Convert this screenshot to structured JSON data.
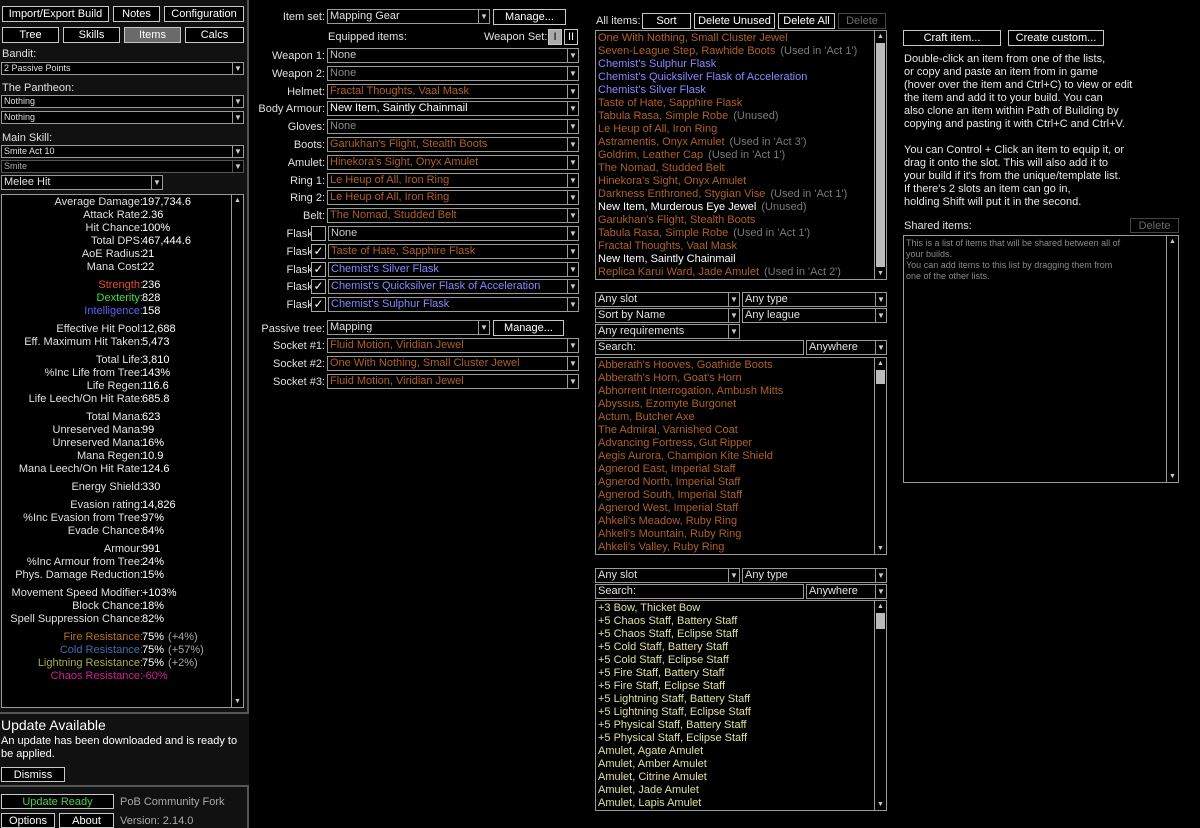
{
  "colors": {
    "unique": "#af6025",
    "magic": "#8888ff",
    "normal": "#c8c8c8",
    "gem": "#c8c8c8",
    "strength": "#e05030",
    "dexterity": "#40e040",
    "intelligence": "#6060f0",
    "fire": "#b97123",
    "cold": "#3f6db3",
    "lightning": "#adaa47",
    "chaos": "#d02090",
    "relic": "#e0e0a0",
    "green": "#50d050",
    "panel_bg": "#0c0c10"
  },
  "top_buttons": {
    "import_export": "Import/Export Build",
    "notes": "Notes",
    "configuration": "Configuration",
    "tree": "Tree",
    "skills": "Skills",
    "items": "Items",
    "calcs": "Calcs"
  },
  "left": {
    "bandit_label": "Bandit:",
    "bandit_value": "2 Passive Points",
    "pantheon_label": "The Pantheon:",
    "pantheon_major": "Nothing",
    "pantheon_minor": "Nothing",
    "main_skill_label": "Main Skill:",
    "main_skill_value": "Smite Act 10",
    "main_skill_sub": "Smite",
    "skill_part": "Melee Hit",
    "stats": [
      {
        "k": "Average Damage:",
        "v": "197,734.6"
      },
      {
        "k": "Attack Rate:",
        "v": "2.36"
      },
      {
        "k": "Hit Chance:",
        "v": "100%"
      },
      {
        "k": "Total DPS:",
        "v": "467,444.6"
      },
      {
        "k": "AoE Radius:",
        "v": "21"
      },
      {
        "k": "Mana Cost:",
        "v": "22"
      },
      {
        "gap": true
      },
      {
        "k": "Strength:",
        "v": "236",
        "c": "strength"
      },
      {
        "k": "Dexterity:",
        "v": "828",
        "c": "dexterity"
      },
      {
        "k": "Intelligence:",
        "v": "158",
        "c": "intelligence"
      },
      {
        "gap": true
      },
      {
        "k": "Effective Hit Pool:",
        "v": "12,688"
      },
      {
        "k": "Eff. Maximum Hit Taken:",
        "v": "5,473"
      },
      {
        "gap": true
      },
      {
        "k": "Total Life:",
        "v": "3,810"
      },
      {
        "k": "%Inc Life from Tree:",
        "v": "143%"
      },
      {
        "k": "Life Regen:",
        "v": "116.6"
      },
      {
        "k": "Life Leech/On Hit Rate:",
        "v": "685.8"
      },
      {
        "gap": true
      },
      {
        "k": "Total Mana:",
        "v": "623"
      },
      {
        "k": "Unreserved Mana:",
        "v": "99"
      },
      {
        "k": "Unreserved Mana:",
        "v": "16%"
      },
      {
        "k": "Mana Regen:",
        "v": "10.9"
      },
      {
        "k": "Mana Leech/On Hit Rate:",
        "v": "124.6"
      },
      {
        "gap": true
      },
      {
        "k": "Energy Shield:",
        "v": "330"
      },
      {
        "gap": true
      },
      {
        "k": "Evasion rating:",
        "v": "14,826"
      },
      {
        "k": "%Inc Evasion from Tree:",
        "v": "97%"
      },
      {
        "k": "Evade Chance:",
        "v": "64%"
      },
      {
        "gap": true
      },
      {
        "k": "Armour:",
        "v": "991"
      },
      {
        "k": "%Inc Armour from Tree:",
        "v": "24%"
      },
      {
        "k": "Phys. Damage Reduction:",
        "v": "15%"
      },
      {
        "gap": true
      },
      {
        "k": "Movement Speed Modifier:",
        "v": "+103%"
      },
      {
        "k": "Block Chance:",
        "v": "18%"
      },
      {
        "k": "Spell Suppression Chance:",
        "v": "82%"
      },
      {
        "gap": true
      },
      {
        "k": "Fire Resistance:",
        "v": "75%",
        "x": "(+4%)",
        "c": "fire"
      },
      {
        "k": "Cold Resistance:",
        "v": "75%",
        "x": "(+57%)",
        "c": "cold"
      },
      {
        "k": "Lightning Resistance:",
        "v": "75%",
        "x": "(+2%)",
        "c": "lightning"
      },
      {
        "k": "Chaos Resistance:",
        "v": "-60%",
        "c": "chaos",
        "vc": "chaos"
      }
    ],
    "update_title": "Update Available",
    "update_text": "An update has been downloaded and is ready to be applied.",
    "dismiss": "Dismiss",
    "update_ready": "Update Ready",
    "fork": "PoB Community Fork",
    "options": "Options",
    "about": "About",
    "version": "Version: 2.14.0"
  },
  "mid": {
    "item_set_label": "Item set:",
    "item_set_value": "Mapping Gear",
    "manage": "Manage...",
    "equipped_label": "Equipped items:",
    "weapon_set_label": "Weapon Set:",
    "ws1": "I",
    "ws2": "II",
    "slots": [
      {
        "label": "Weapon 1:",
        "value": "None",
        "c": "normal"
      },
      {
        "label": "Weapon 2:",
        "value": "None",
        "c": "dim"
      },
      {
        "label": "Helmet:",
        "value": "Fractal Thoughts, Vaal Mask",
        "c": "unique"
      },
      {
        "label": "Body Armour:",
        "value": "New Item, Saintly Chainmail",
        "c": "white"
      },
      {
        "label": "Gloves:",
        "value": "None",
        "c": "dim"
      },
      {
        "label": "Boots:",
        "value": "Garukhan's Flight, Stealth Boots",
        "c": "unique"
      },
      {
        "label": "Amulet:",
        "value": "Hinekora's Sight, Onyx Amulet",
        "c": "unique"
      },
      {
        "label": "Ring 1:",
        "value": "Le Heup of All, Iron Ring",
        "c": "unique"
      },
      {
        "label": "Ring 2:",
        "value": "Le Heup of All, Iron Ring",
        "c": "unique"
      },
      {
        "label": "Belt:",
        "value": "The Nomad, Studded Belt",
        "c": "unique"
      }
    ],
    "flasks": [
      {
        "label": "Flask 1:",
        "value": "None",
        "c": "normal",
        "checked": ""
      },
      {
        "label": "Flask 2:",
        "value": "Taste of Hate, Sapphire Flask",
        "c": "unique",
        "checked": "✓"
      },
      {
        "label": "Flask 3:",
        "value": "Chemist's Silver Flask",
        "c": "magic",
        "checked": "✓"
      },
      {
        "label": "Flask 4:",
        "value": "Chemist's Quicksilver Flask of Acceleration",
        "c": "magic",
        "checked": "✓"
      },
      {
        "label": "Flask 5:",
        "value": "Chemist's Sulphur Flask",
        "c": "magic",
        "checked": "✓"
      }
    ],
    "passive_label": "Passive tree:",
    "passive_value": "Mapping",
    "passive_manage": "Manage...",
    "sockets": [
      {
        "label": "Socket #1:",
        "value": "Fluid Motion, Viridian Jewel",
        "c": "unique"
      },
      {
        "label": "Socket #2:",
        "value": "One With Nothing, Small Cluster Jewel",
        "c": "unique"
      },
      {
        "label": "Socket #3:",
        "value": "Fluid Motion, Viridian Jewel",
        "c": "unique"
      }
    ]
  },
  "all_items": {
    "label": "All items:",
    "sort": "Sort",
    "delete_unused": "Delete Unused",
    "delete_all": "Delete All",
    "delete": "Delete",
    "items": [
      {
        "t": "One With Nothing, Small Cluster Jewel",
        "c": "unique",
        "n": ""
      },
      {
        "t": "Seven-League Step, Rawhide Boots",
        "c": "unique",
        "n": "(Used in 'Act 1')"
      },
      {
        "t": "Chemist's Sulphur Flask",
        "c": "magic",
        "n": ""
      },
      {
        "t": "Chemist's Quicksilver Flask of Acceleration",
        "c": "magic",
        "n": ""
      },
      {
        "t": "Chemist's Silver Flask",
        "c": "magic",
        "n": ""
      },
      {
        "t": "Taste of Hate, Sapphire Flask",
        "c": "unique",
        "n": ""
      },
      {
        "t": "Tabula Rasa, Simple Robe",
        "c": "unique",
        "n": "(Unused)"
      },
      {
        "t": "Le Heup of All, Iron Ring",
        "c": "unique",
        "n": ""
      },
      {
        "t": "Astramentis, Onyx Amulet",
        "c": "unique",
        "n": "(Used in 'Act 3')"
      },
      {
        "t": "Goldrim, Leather Cap",
        "c": "unique",
        "n": "(Used in 'Act 1')"
      },
      {
        "t": "The Nomad, Studded Belt",
        "c": "unique",
        "n": ""
      },
      {
        "t": "Hinekora's Sight, Onyx Amulet",
        "c": "unique",
        "n": ""
      },
      {
        "t": "Darkness Enthroned, Stygian Vise",
        "c": "unique",
        "n": "(Used in 'Act 1')"
      },
      {
        "t": "New Item, Murderous Eye Jewel",
        "c": "white",
        "n": "(Unused)"
      },
      {
        "t": "Garukhan's Flight, Stealth Boots",
        "c": "unique",
        "n": ""
      },
      {
        "t": "Tabula Rasa, Simple Robe",
        "c": "unique",
        "n": "(Used in 'Act 1')"
      },
      {
        "t": "Fractal Thoughts, Vaal Mask",
        "c": "unique",
        "n": ""
      },
      {
        "t": "New Item, Saintly Chainmail",
        "c": "white",
        "n": ""
      },
      {
        "t": "Replica Karui Ward, Jade Amulet",
        "c": "unique",
        "n": "(Used in 'Act 2')"
      }
    ]
  },
  "unique_db": {
    "slot": "Any slot",
    "type": "Any type",
    "sort": "Sort by Name",
    "league": "Any league",
    "req": "Any requirements",
    "search_label": "Search:",
    "search_where": "Anywhere",
    "items": [
      "Abberath's Hooves, Goathide Boots",
      "Abberath's Horn, Goat's Horn",
      "Abhorrent Interrogation, Ambush Mitts",
      "Abyssus, Ezomyte Burgonet",
      "Actum, Butcher Axe",
      "The Admiral, Varnished Coat",
      "Advancing Fortress, Gut Ripper",
      "Aegis Aurora, Champion Kite Shield",
      "Agnerod East, Imperial Staff",
      "Agnerod North, Imperial Staff",
      "Agnerod South, Imperial Staff",
      "Agnerod West, Imperial Staff",
      "Ahkeli's Meadow, Ruby Ring",
      "Ahkeli's Mountain, Ruby Ring",
      "Ahkeli's Valley, Ruby Ring"
    ]
  },
  "template_db": {
    "slot": "Any slot",
    "type": "Any type",
    "search_label": "Search:",
    "search_where": "Anywhere",
    "items": [
      "+3 Bow, Thicket Bow",
      "+5 Chaos Staff, Battery Staff",
      "+5 Chaos Staff, Eclipse Staff",
      "+5 Cold Staff, Battery Staff",
      "+5 Cold Staff, Eclipse Staff",
      "+5 Fire Staff, Battery Staff",
      "+5 Fire Staff, Eclipse Staff",
      "+5 Lightning Staff, Battery Staff",
      "+5 Lightning Staff, Eclipse Staff",
      "+5 Physical Staff, Battery Staff",
      "+5 Physical Staff, Eclipse Staff",
      "Amulet, Agate Amulet",
      "Amulet, Amber Amulet",
      "Amulet, Citrine Amulet",
      "Amulet, Jade Amulet",
      "Amulet, Lapis Amulet"
    ]
  },
  "right": {
    "craft": "Craft item...",
    "create_custom": "Create custom...",
    "help1": [
      "Double-click an item from one of the lists,",
      "or copy and paste an item from in game",
      "(hover over the item and Ctrl+C) to view or edit",
      "the item and add it to your build. You can",
      "also clone an item within Path of Building by",
      "copying and pasting it with Ctrl+C and Ctrl+V."
    ],
    "help2": [
      "You can Control + Click an item to equip it, or",
      "drag it onto the slot.  This will also add it to",
      "your build if it's from the unique/template list.",
      "If there's 2 slots an item can go in,",
      "holding Shift will put it in the second."
    ],
    "shared_label": "Shared items:",
    "shared_delete": "Delete",
    "shared_text": [
      "This is a list of items that will be shared between all of",
      "your builds.",
      "You can add items to this list by dragging them from",
      "one of the other lists."
    ]
  }
}
